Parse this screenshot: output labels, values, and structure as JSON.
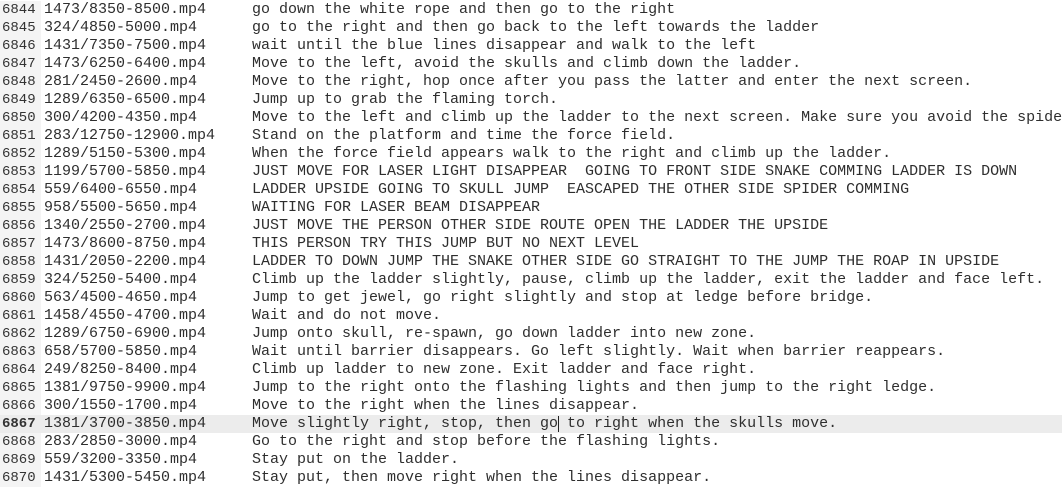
{
  "editor": {
    "current_line": 6867,
    "cursor_column": 34,
    "lines": [
      {
        "n": "6844",
        "file": "1473/8350-8500.mp4",
        "text": "go down the white rope and then go to the right"
      },
      {
        "n": "6845",
        "file": "324/4850-5000.mp4",
        "text": "go to the right and then go back to the left towards the ladder"
      },
      {
        "n": "6846",
        "file": "1431/7350-7500.mp4",
        "text": "wait until the blue lines disappear and walk to the left"
      },
      {
        "n": "6847",
        "file": "1473/6250-6400.mp4",
        "text": "Move to the left, avoid the skulls and climb down the ladder."
      },
      {
        "n": "6848",
        "file": "281/2450-2600.mp4",
        "text": "Move to the right, hop once after you pass the latter and enter the next screen."
      },
      {
        "n": "6849",
        "file": "1289/6350-6500.mp4",
        "text": "Jump up to grab the flaming torch."
      },
      {
        "n": "6850",
        "file": "300/4200-4350.mp4",
        "text": "Move to the left and climb up the ladder to the next screen. Make sure you avoid the spide"
      },
      {
        "n": "6851",
        "file": "283/12750-12900.mp4",
        "text": "Stand on the platform and time the force field."
      },
      {
        "n": "6852",
        "file": "1289/5150-5300.mp4",
        "text": "When the force field appears walk to the right and climb up the ladder."
      },
      {
        "n": "6853",
        "file": "1199/5700-5850.mp4",
        "text": "JUST MOVE FOR LASER LIGHT DISAPPEAR  GOING TO FRONT SIDE SNAKE COMMING LADDER IS DOWN"
      },
      {
        "n": "6854",
        "file": "559/6400-6550.mp4",
        "text": "LADDER UPSIDE GOING TO SKULL JUMP  EASCAPED THE OTHER SIDE SPIDER COMMING"
      },
      {
        "n": "6855",
        "file": "958/5500-5650.mp4",
        "text": "WAITING FOR LASER BEAM DISAPPEAR"
      },
      {
        "n": "6856",
        "file": "1340/2550-2700.mp4",
        "text": "JUST MOVE THE PERSON OTHER SIDE ROUTE OPEN THE LADDER THE UPSIDE"
      },
      {
        "n": "6857",
        "file": "1473/8600-8750.mp4",
        "text": "THIS PERSON TRY THIS JUMP BUT NO NEXT LEVEL"
      },
      {
        "n": "6858",
        "file": "1431/2050-2200.mp4",
        "text": "LADDER TO DOWN JUMP THE SNAKE OTHER SIDE GO STRAIGHT TO THE JUMP THE ROAP IN UPSIDE"
      },
      {
        "n": "6859",
        "file": "324/5250-5400.mp4",
        "text": "Climb up the ladder slightly, pause, climb up the ladder, exit the ladder and face left."
      },
      {
        "n": "6860",
        "file": "563/4500-4650.mp4",
        "text": "Jump to get jewel, go right slightly and stop at ledge before bridge."
      },
      {
        "n": "6861",
        "file": "1458/4550-4700.mp4",
        "text": "Wait and do not move."
      },
      {
        "n": "6862",
        "file": "1289/6750-6900.mp4",
        "text": "Jump onto skull, re-spawn, go down ladder into new zone."
      },
      {
        "n": "6863",
        "file": "658/5700-5850.mp4",
        "text": "Wait until barrier disappears. Go left slightly. Wait when barrier reappears."
      },
      {
        "n": "6864",
        "file": "249/8250-8400.mp4",
        "text": "Climb up ladder to new zone. Exit ladder and face right."
      },
      {
        "n": "6865",
        "file": "1381/9750-9900.mp4",
        "text": "Jump to the right onto the flashing lights and then jump to the right ledge."
      },
      {
        "n": "6866",
        "file": "300/1550-1700.mp4",
        "text": "Move to the right when the lines disappear."
      },
      {
        "n": "6867",
        "file": "1381/3700-3850.mp4",
        "text": "Move slightly right, stop, then go to right when the skulls move."
      },
      {
        "n": "6868",
        "file": "283/2850-3000.mp4",
        "text": "Go to the right and stop before the flashing lights."
      },
      {
        "n": "6869",
        "file": "559/3200-3350.mp4",
        "text": "Stay put on the ladder."
      },
      {
        "n": "6870",
        "file": "1431/5300-5450.mp4",
        "text": "Stay put, then move right when the lines disappear."
      }
    ]
  }
}
